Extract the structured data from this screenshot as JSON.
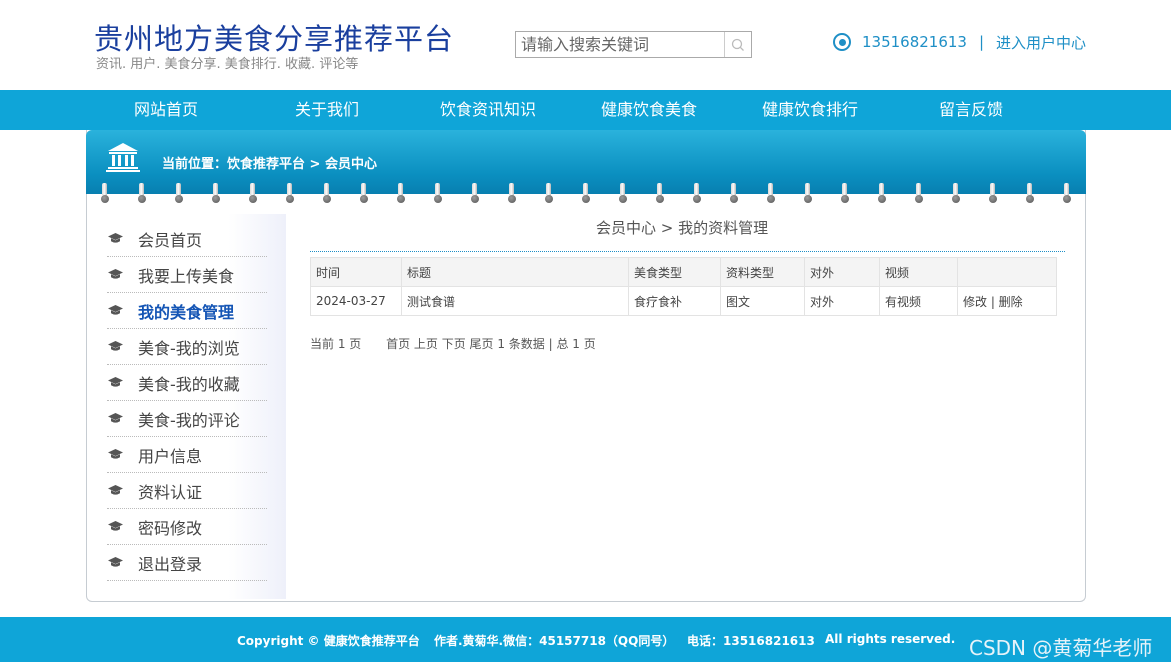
{
  "header": {
    "title": "贵州地方美食分享推荐平台",
    "subtitle": "资讯. 用户. 美食分享. 美食排行. 收藏. 评论等",
    "search_placeholder": "请输入搜索关键词",
    "phone": "13516821613",
    "separator": "|",
    "user_center_link": "进入用户中心"
  },
  "nav": [
    "网站首页",
    "关于我们",
    "饮食资讯知识",
    "健康饮食美食",
    "健康饮食排行",
    "留言反馈"
  ],
  "breadcrumb": "当前位置：饮食推荐平台 > 会员中心",
  "sidebar": {
    "items": [
      "会员首页",
      "我要上传美食",
      "我的美食管理",
      "美食-我的浏览",
      "美食-我的收藏",
      "美食-我的评论",
      "用户信息",
      "资料认证",
      "密码修改",
      "退出登录"
    ],
    "active_index": 2
  },
  "main": {
    "title": "会员中心 > 我的资料管理",
    "table": {
      "headers": [
        "时间",
        "标题",
        "美食类型",
        "资料类型",
        "对外",
        "视频",
        ""
      ],
      "rows": [
        [
          "2024-03-27",
          "测试食谱",
          "食疗食补",
          "图文",
          "对外",
          "有视频",
          "修改 | 删除"
        ]
      ]
    },
    "pager": {
      "current": "当前 1 页",
      "links": "首页 上页 下页 尾页 1 条数据 | 总 1 页"
    }
  },
  "footer": {
    "copyright": "Copyright © 健康饮食推荐平台",
    "author": "作者.黄菊华.微信：45157718（QQ同号）",
    "phone": "电话：13516821613",
    "rights": "All rights reserved.",
    "watermark": "CSDN @黄菊华老师"
  },
  "colors": {
    "nav_bg": "#0fa5d8",
    "title": "#1a3f9e",
    "accent": "#1e8fc6",
    "active_menu": "#1455b5"
  },
  "icons": [
    "search-icon",
    "location-icon",
    "bank-icon",
    "graduation-cap-icon"
  ]
}
